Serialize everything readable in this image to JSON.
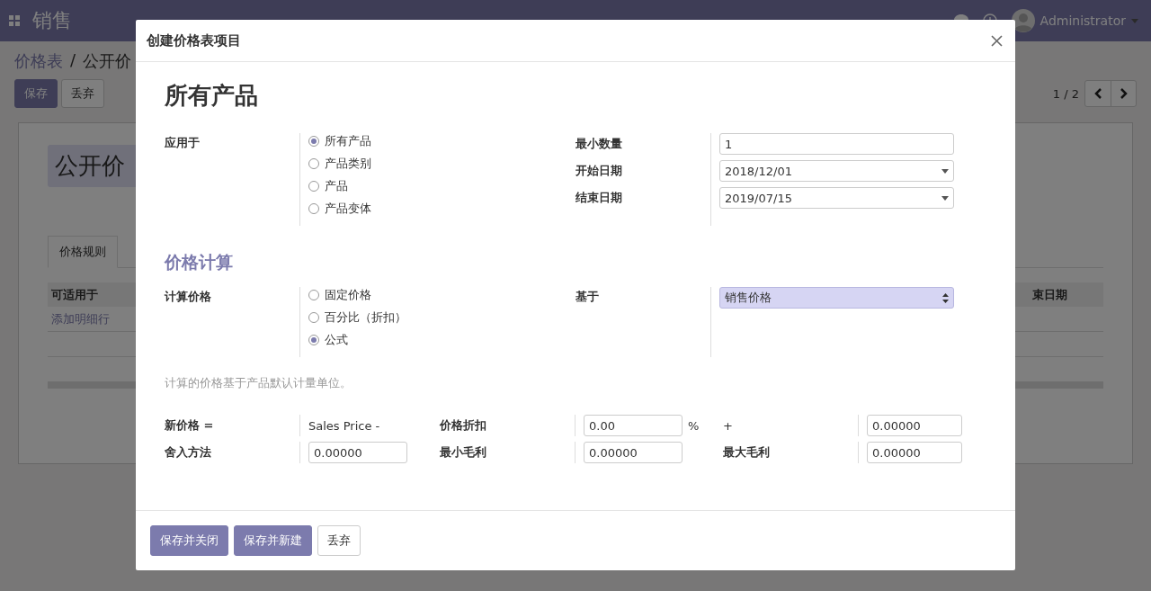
{
  "navbar": {
    "app_title": "销售",
    "user": "Administrator"
  },
  "breadcrumbs": [
    "价格表",
    "公开价"
  ],
  "breadcrumb_separator": "/",
  "actions": [
    {
      "label": "保存",
      "kind": "primary"
    },
    {
      "label": "丢弃",
      "kind": "secondary"
    }
  ],
  "pager": "1 / 2",
  "record": {
    "name": "公开价",
    "tabs": [
      {
        "label": "价格规则",
        "selected": true
      }
    ],
    "columns": [
      "可适用于",
      "束日期"
    ],
    "add_line": "添加明细行"
  },
  "dialog": {
    "title": "创建价格表项目",
    "heading": "所有产品",
    "apply_on": {
      "label": "应用于",
      "options": [
        {
          "label": "所有产品",
          "selected": true
        },
        {
          "label": "产品类别",
          "selected": false
        },
        {
          "label": "产品",
          "selected": false
        },
        {
          "label": "产品变体",
          "selected": false
        }
      ]
    },
    "fields": [
      {
        "label": "最小数量",
        "value": "1",
        "kind": "text"
      },
      {
        "label": "开始日期",
        "value": "2018/12/01",
        "kind": "date"
      },
      {
        "label": "结束日期",
        "value": "2019/07/15",
        "kind": "date"
      }
    ],
    "section_title": "价格计算",
    "compute": {
      "label": "计算价格",
      "options": [
        {
          "label": "固定价格",
          "selected": false
        },
        {
          "label": "百分比（折扣）",
          "selected": false
        },
        {
          "label": "公式",
          "selected": true
        }
      ]
    },
    "based_on": {
      "label": "基于",
      "value": "销售价格"
    },
    "help": "计算的价格基于产品默认计量单位。",
    "formula": [
      [
        {
          "kind": "label",
          "text": "新价格 ="
        },
        {
          "kind": "text",
          "text": "Sales Price -"
        },
        {
          "kind": "label",
          "text": "价格折扣"
        },
        {
          "kind": "input",
          "value": "0.00",
          "suffix": "%"
        },
        {
          "kind": "text",
          "text": "+"
        },
        {
          "kind": "input",
          "value": "0.00000"
        }
      ],
      [
        {
          "kind": "label",
          "text": "舍入方法"
        },
        {
          "kind": "input",
          "value": "0.00000"
        },
        {
          "kind": "label",
          "text": "最小毛利"
        },
        {
          "kind": "input",
          "value": "0.00000"
        },
        {
          "kind": "label",
          "text": "最大毛利"
        },
        {
          "kind": "input",
          "value": "0.00000"
        }
      ]
    ],
    "buttons": [
      {
        "label": "保存并关闭",
        "kind": "primary"
      },
      {
        "label": "保存并新建",
        "kind": "primary"
      },
      {
        "label": "丢弃",
        "kind": "secondary"
      }
    ]
  }
}
